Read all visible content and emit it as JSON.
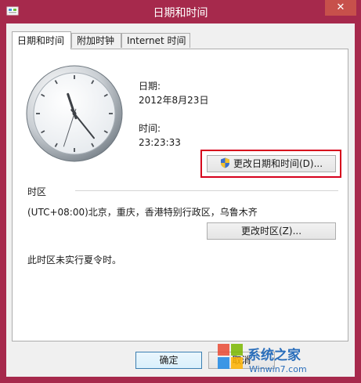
{
  "window": {
    "title": "日期和时间",
    "close_label": "✕"
  },
  "tabs": [
    {
      "label": "日期和时间",
      "active": true
    },
    {
      "label": "附加时钟",
      "active": false
    },
    {
      "label": "Internet 时间",
      "active": false
    }
  ],
  "datetime": {
    "date_label": "日期:",
    "date_value": "2012年8月23日",
    "time_label": "时间:",
    "time_value": "23:23:33",
    "change_button": "更改日期和时间(D)..."
  },
  "clock": {
    "hour": 11,
    "minute": 23,
    "second": 33
  },
  "timezone": {
    "section_label": "时区",
    "value": "(UTC+08:00)北京，重庆，香港特别行政区，乌鲁木齐",
    "change_button": "更改时区(Z)...",
    "dst_note": "此时区未实行夏令时。"
  },
  "footer": {
    "ok_button": "确定",
    "cancel_button": "取消"
  },
  "watermark": {
    "brand": "系统之家",
    "site": "Winwin7.com"
  },
  "colors": {
    "titlebar": "#a6294c",
    "close": "#c7504b",
    "highlight": "#d6001c"
  }
}
